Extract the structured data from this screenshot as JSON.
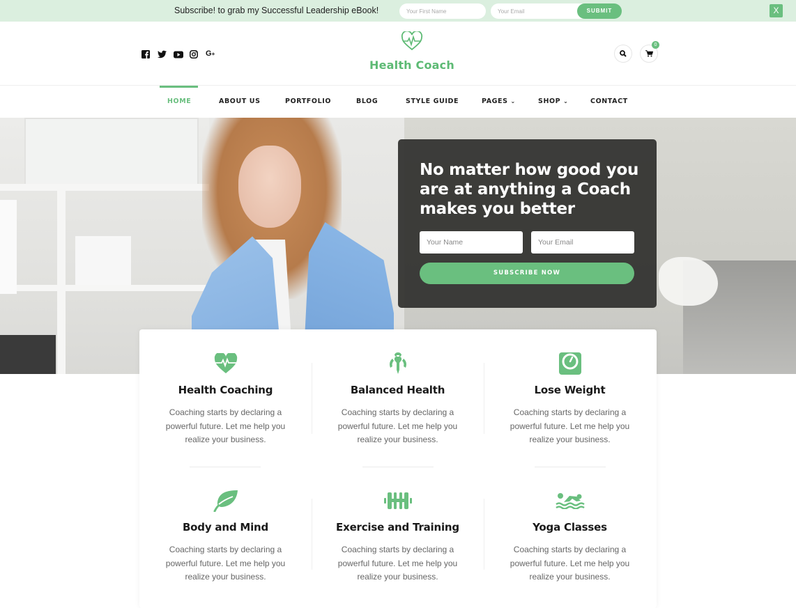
{
  "topbar": {
    "message": "Subscribe! to grab my Successful Leadership eBook!",
    "first_name_placeholder": "Your First Name",
    "email_placeholder": "Your Email",
    "submit_label": "SUBMIT",
    "close_label": "X"
  },
  "header": {
    "social": [
      "facebook",
      "twitter",
      "youtube",
      "instagram",
      "google-plus"
    ],
    "logo_text": "Health Coach",
    "cart_count": "0"
  },
  "nav": {
    "items": [
      {
        "label": "HOME",
        "active": true
      },
      {
        "label": "ABOUT US"
      },
      {
        "label": "PORTFOLIO"
      },
      {
        "label": "BLOG"
      },
      {
        "label": "STYLE GUIDE"
      },
      {
        "label": "PAGES",
        "dropdown": true
      },
      {
        "label": "SHOP",
        "dropdown": true
      },
      {
        "label": "CONTACT"
      }
    ]
  },
  "hero": {
    "headline": "No matter how good you are at anything a Coach makes you better",
    "name_placeholder": "Your Name",
    "email_placeholder": "Your Email",
    "button_label": "SUBSCRIBE NOW"
  },
  "services": [
    {
      "icon": "heartbeat-icon",
      "title": "Health Coaching",
      "text": "Coaching starts by declaring a powerful future. Let me help you realize your business."
    },
    {
      "icon": "mandalorian-icon",
      "title": "Balanced Health",
      "text": "Coaching starts by declaring a powerful future. Let me help you realize your business."
    },
    {
      "icon": "weight-scale-icon",
      "title": "Lose Weight",
      "text": "Coaching starts by declaring a powerful future. Let me help you realize your business."
    },
    {
      "icon": "leaf-icon",
      "title": "Body and Mind",
      "text": "Coaching starts by declaring a powerful future. Let me help you realize your business."
    },
    {
      "icon": "dumbbell-icon",
      "title": "Exercise and Training",
      "text": "Coaching starts by declaring a powerful future. Let me help you realize your business."
    },
    {
      "icon": "swimmer-icon",
      "title": "Yoga Classes",
      "text": "Coaching starts by declaring a powerful future. Let me help you realize your business."
    }
  ],
  "colors": {
    "accent": "#6abf7f",
    "topbar_bg": "#dbefdf",
    "cta_bg": "#323230"
  }
}
